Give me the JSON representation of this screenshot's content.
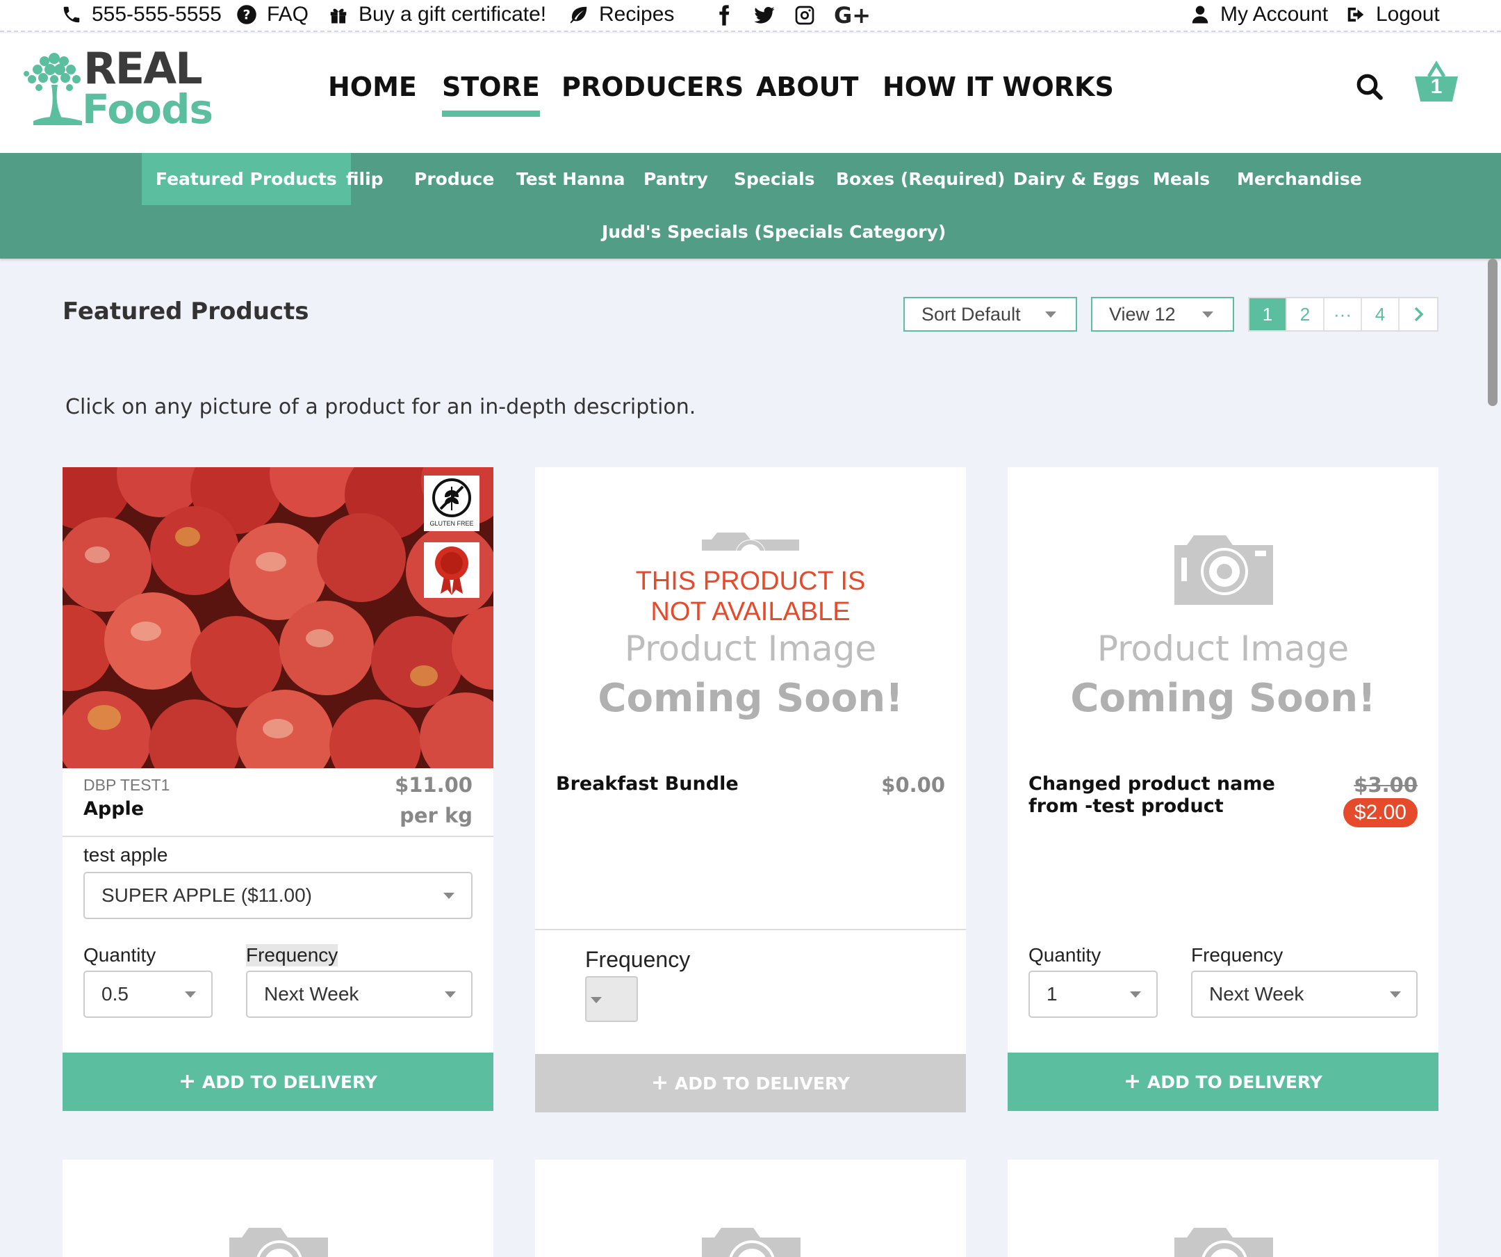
{
  "topbar": {
    "phone": "555-555-5555",
    "faq": "FAQ",
    "gift": "Buy a gift certificate!",
    "recipes": "Recipes",
    "social_gplus": "G+",
    "account": "My Account",
    "logout": "Logout"
  },
  "logo": {
    "line1": "REAL",
    "line2": "Foods"
  },
  "nav": {
    "home": "HOME",
    "store": "STORE",
    "producers": "PRODUCERS",
    "about": "ABOUT",
    "how": "HOW IT WORKS",
    "cart_count": "1"
  },
  "categories": [
    "Featured Products",
    "filip",
    "Produce",
    "Test Hanna",
    "Pantry",
    "Specials",
    "Boxes (Required)",
    "Dairy & Eggs",
    "Meals",
    "Merchandise",
    "Judd's Specials (Specials Category)"
  ],
  "listing": {
    "title": "Featured Products",
    "sort": "Sort Default",
    "view": "View 12",
    "pages": [
      "1",
      "2",
      "···",
      "4"
    ],
    "intro": "Click on any picture of a product for an in-depth description."
  },
  "placeholder": {
    "line1": "Product Image",
    "line2": "Coming Soon!"
  },
  "badges": {
    "gluten_free": "GLUTEN FREE"
  },
  "cards": [
    {
      "producer": "DBP TEST1",
      "name": "Apple",
      "price": "$11.00",
      "unit": "per kg",
      "option_label": "test apple",
      "option_value": "SUPER APPLE ($11.00)",
      "quantity_label": "Quantity",
      "quantity_value": "0.5",
      "frequency_label": "Frequency",
      "frequency_value": "Next Week",
      "button": "ADD TO DELIVERY"
    },
    {
      "unavailable": "THIS PRODUCT IS NOT AVAILABLE",
      "name": "Breakfast Bundle",
      "price": "$0.00",
      "frequency_label": "Frequency",
      "button": "ADD TO DELIVERY"
    },
    {
      "name": "Changed product name from -test product",
      "old_price": "$3.00",
      "sale_price": "$2.00",
      "quantity_label": "Quantity",
      "quantity_value": "1",
      "frequency_label": "Frequency",
      "frequency_value": "Next Week",
      "button": "ADD TO DELIVERY"
    }
  ]
}
